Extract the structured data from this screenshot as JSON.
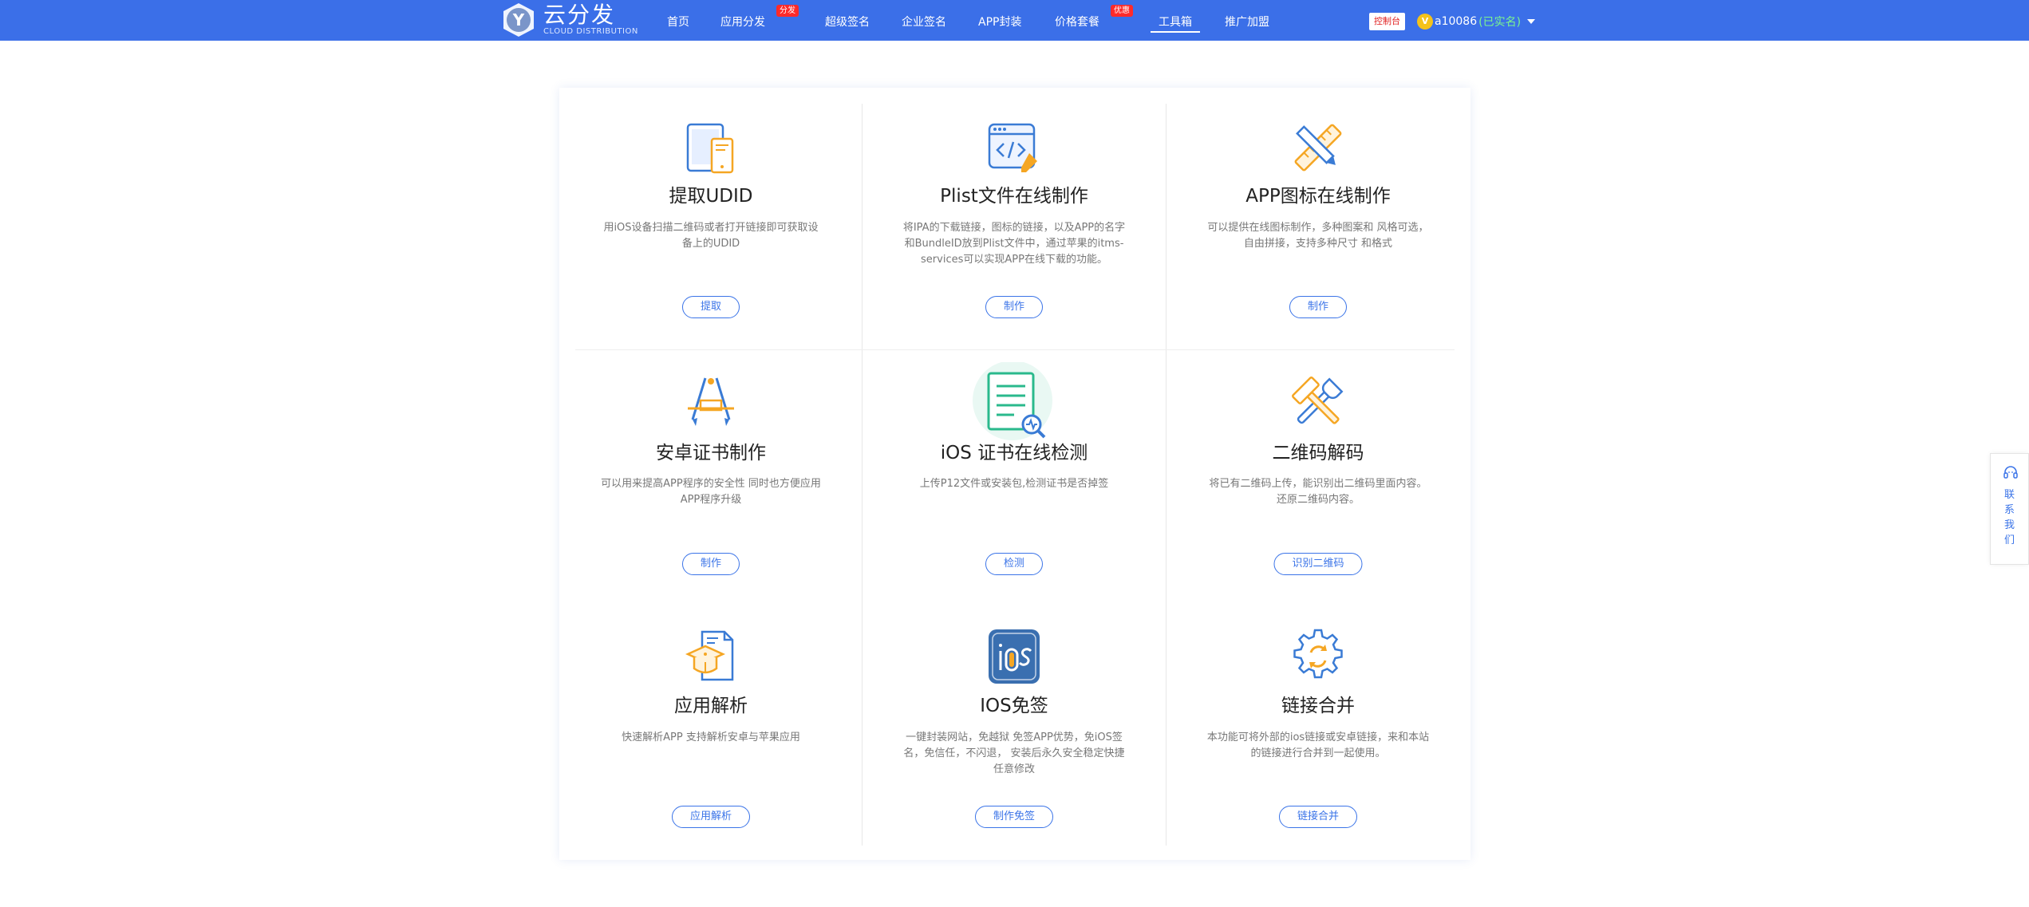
{
  "brand": {
    "name_cn": "云分发",
    "name_en": "CLOUD DISTRIBUTION",
    "logo_letter": "Y",
    "color": "#3b6fe8"
  },
  "nav": {
    "items": [
      {
        "label": "首页"
      },
      {
        "label": "应用分发",
        "badge": "分发"
      },
      {
        "label": "超级签名"
      },
      {
        "label": "企业签名"
      },
      {
        "label": "APP封装"
      },
      {
        "label": "价格套餐",
        "badge": "优惠"
      },
      {
        "label": "工具箱",
        "active": true
      },
      {
        "label": "推广加盟"
      }
    ]
  },
  "header_right": {
    "console": "控制台",
    "vip_letter": "V",
    "username": "a10086",
    "verified": "(已实名)"
  },
  "tools": [
    {
      "title": "提取UDID",
      "desc": "用iOS设备扫描二维码或者打开链接即可获取设备上的UDID",
      "button": "提取",
      "icon": "phone-tablet-icon"
    },
    {
      "title": "Plist文件在线制作",
      "desc": "将IPA的下载链接，图标的链接，以及APP的名字和BundleID放到Plist文件中，通过苹果的itms-services可以实现APP在线下载的功能。",
      "button": "制作",
      "icon": "code-window-icon"
    },
    {
      "title": "APP图标在线制作",
      "desc": "可以提供在线图标制作，多种图案和 风格可选，自由拼接，支持多种尺寸 和格式",
      "button": "制作",
      "icon": "pencil-ruler-icon"
    },
    {
      "title": "安卓证书制作",
      "desc": "可以用来提高APP程序的安全性 同时也方便应用APP程序升级",
      "button": "制作",
      "icon": "app-store-icon"
    },
    {
      "title": "iOS 证书在线检测",
      "desc": "上传P12文件或安装包,检测证书是否掉签",
      "button": "检测",
      "icon": "document-search-icon"
    },
    {
      "title": "二维码解码",
      "desc": "将已有二维码上传，能识别出二维码里面内容。 还原二维码内容。",
      "button": "识别二维码",
      "icon": "wrench-hammer-icon"
    },
    {
      "title": "应用解析",
      "desc": "快速解析APP 支持解析安卓与苹果应用",
      "button": "应用解析",
      "icon": "graduation-cap-icon"
    },
    {
      "title": "IOS免签",
      "desc": "一键封装网站，免越狱 免签APP优势，免iOS签名，免信任，不闪退， 安装后永久安全稳定快捷 任意修改",
      "button": "制作免签",
      "icon": "ios-badge-icon"
    },
    {
      "title": "链接合并",
      "desc": "本功能可将外部的ios链接或安卓链接，来和本站的链接进行合并到一起使用。",
      "button": "链接合并",
      "icon": "gear-sync-icon"
    }
  ],
  "contact": {
    "label": "联系我们",
    "icon": "headset-icon"
  },
  "colors": {
    "accent": "#3b74e8",
    "badge_red": "#ff2a2a",
    "icon_blue": "#3a7bd5",
    "icon_orange": "#f5a623",
    "icon_green": "#2ab98c"
  }
}
